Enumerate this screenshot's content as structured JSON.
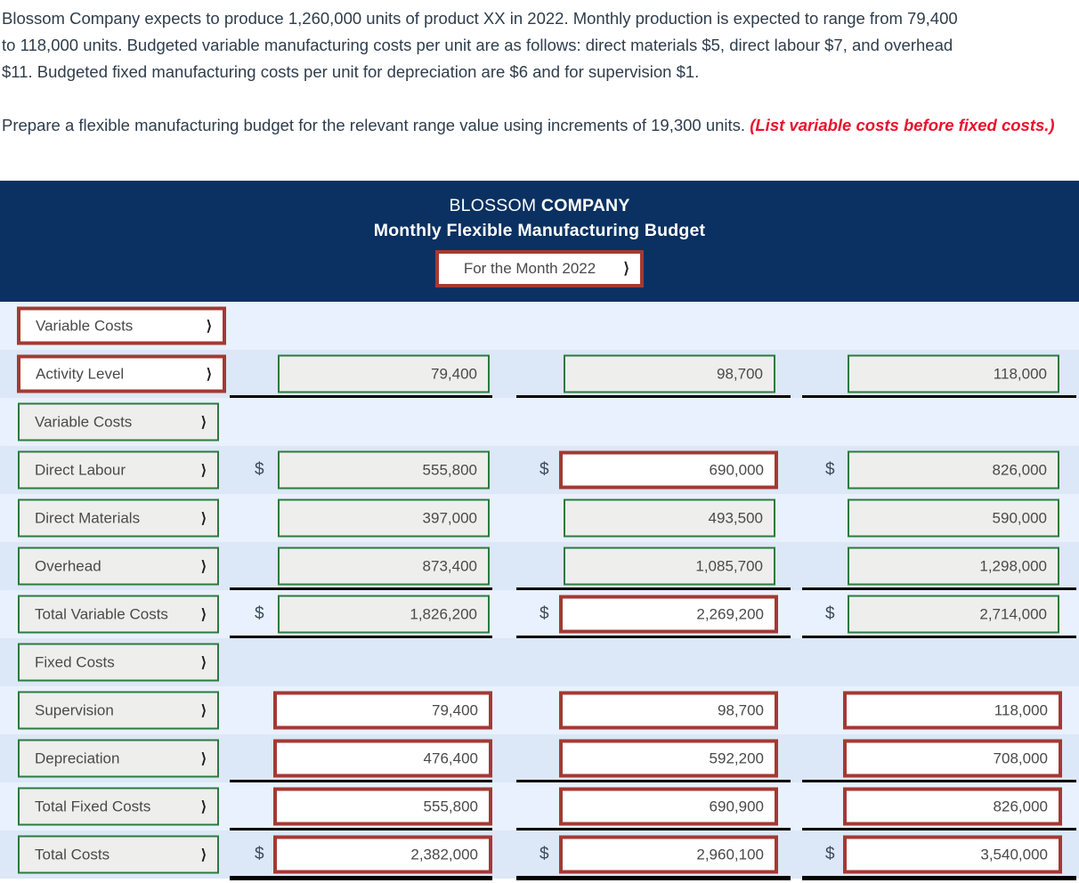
{
  "problem": {
    "line1": "Blossom Company expects to produce 1,260,000 units of product XX in 2022. Monthly production is expected to range from 79,400",
    "line2": "to 118,000 units. Budgeted variable manufacturing costs per unit are as follows: direct materials $5, direct labour $7, and overhead",
    "line3": "$11. Budgeted fixed manufacturing costs per unit for depreciation are $6 and for supervision $1.",
    "prep_text": "Prepare a flexible manufacturing budget for the relevant range value using increments of 19,300 units. ",
    "prep_emphasis": "(List variable costs before fixed costs.)"
  },
  "budget_header": {
    "company_plain": "BLOSSOM ",
    "company_bold": "COMPANY",
    "subtitle": "Monthly Flexible Manufacturing Budget",
    "month_select_value": "For the Month 2022",
    "chevron": "⌄"
  },
  "colors": {
    "header_bg": "#0a3161",
    "border_red": "#a33a33",
    "border_green": "#2c7a3f",
    "row_light": "#e8f1fd",
    "row_dark": "#dce7f7",
    "emphasis_red": "#e8112d"
  },
  "symbols": {
    "dollar": "$",
    "chevron_down": "❯"
  },
  "rows": [
    {
      "label": "Variable Costs",
      "label_style": "red",
      "values": [
        null,
        null,
        null
      ],
      "value_style": "none",
      "dollars": [
        false,
        false,
        false
      ],
      "rules": [
        false,
        false,
        false
      ]
    },
    {
      "label": "Activity Level",
      "label_style": "red",
      "values": [
        "79,400",
        "98,700",
        "118,000"
      ],
      "value_style": "green",
      "dollars": [
        false,
        false,
        false
      ],
      "rules": [
        true,
        true,
        true
      ]
    },
    {
      "label": "Variable Costs",
      "label_style": "green",
      "values": [
        null,
        null,
        null
      ],
      "value_style": "none",
      "dollars": [
        false,
        false,
        false
      ],
      "rules": [
        false,
        false,
        false
      ]
    },
    {
      "label": "Direct Labour",
      "label_style": "green",
      "values": [
        "555,800",
        "690,000",
        "826,000"
      ],
      "value_style": "green",
      "value_style_overrides": [
        null,
        "red",
        null
      ],
      "dollars": [
        true,
        true,
        true
      ],
      "rules": [
        false,
        false,
        false
      ]
    },
    {
      "label": "Direct Materials",
      "label_style": "green",
      "values": [
        "397,000",
        "493,500",
        "590,000"
      ],
      "value_style": "green",
      "dollars": [
        false,
        false,
        false
      ],
      "rules": [
        false,
        false,
        false
      ]
    },
    {
      "label": "Overhead",
      "label_style": "green",
      "values": [
        "873,400",
        "1,085,700",
        "1,298,000"
      ],
      "value_style": "green",
      "dollars": [
        false,
        false,
        false
      ],
      "rules": [
        true,
        true,
        true
      ]
    },
    {
      "label": "Total Variable Costs",
      "label_style": "green",
      "values": [
        "1,826,200",
        "2,269,200",
        "2,714,000"
      ],
      "value_style": "green",
      "value_style_overrides": [
        null,
        "red",
        null
      ],
      "dollars": [
        true,
        true,
        true
      ],
      "rules": [
        true,
        true,
        true
      ]
    },
    {
      "label": "Fixed Costs",
      "label_style": "green",
      "values": [
        null,
        null,
        null
      ],
      "value_style": "none",
      "dollars": [
        false,
        false,
        false
      ],
      "rules": [
        false,
        false,
        false
      ]
    },
    {
      "label": "Supervision",
      "label_style": "green",
      "values": [
        "79,400",
        "98,700",
        "118,000"
      ],
      "value_style": "red",
      "dollars": [
        false,
        false,
        false
      ],
      "rules": [
        false,
        false,
        false
      ]
    },
    {
      "label": "Depreciation",
      "label_style": "green",
      "values": [
        "476,400",
        "592,200",
        "708,000"
      ],
      "value_style": "red",
      "dollars": [
        false,
        false,
        false
      ],
      "rules": [
        true,
        true,
        true
      ]
    },
    {
      "label": "Total Fixed Costs",
      "label_style": "green",
      "values": [
        "555,800",
        "690,900",
        "826,000"
      ],
      "value_style": "red",
      "dollars": [
        false,
        false,
        false
      ],
      "rules": [
        true,
        true,
        true
      ]
    },
    {
      "label": "Total Costs",
      "label_style": "green",
      "values": [
        "2,382,000",
        "2,960,100",
        "3,540,000"
      ],
      "value_style": "red",
      "dollars": [
        true,
        true,
        true
      ],
      "rules": [
        true,
        true,
        true
      ]
    }
  ]
}
